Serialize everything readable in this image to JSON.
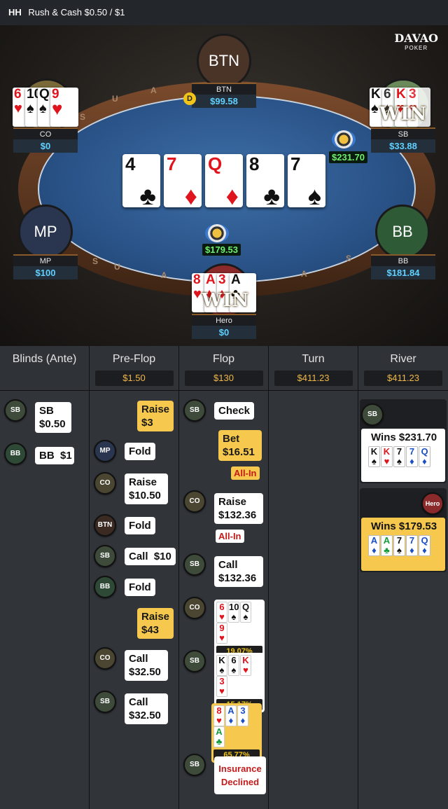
{
  "header": {
    "game_type": "HH",
    "title": "Rush & Cash $0.50 / $1"
  },
  "logo": {
    "brand": "DAVAO",
    "sub": "POKER"
  },
  "seats": {
    "btn": {
      "avatar": "BTN",
      "name": "BTN",
      "stack": "$99.58"
    },
    "co": {
      "name": "CO",
      "stack": "$0"
    },
    "sb": {
      "name": "SB",
      "stack": "$33.88"
    },
    "mp": {
      "avatar": "MP",
      "name": "MP",
      "stack": "$100"
    },
    "bb": {
      "avatar": "BB",
      "name": "BB",
      "stack": "$181.84"
    },
    "hero": {
      "name": "Hero",
      "stack": "$0"
    }
  },
  "hole_cards": {
    "co": [
      {
        "r": "6",
        "s": "♥",
        "c": "red"
      },
      {
        "r": "10",
        "s": "♠",
        "c": "blk"
      },
      {
        "r": "Q",
        "s": "♠",
        "c": "blk"
      },
      {
        "r": "9",
        "s": "♥",
        "c": "red"
      }
    ],
    "sb": [
      {
        "r": "K",
        "s": "♠",
        "c": "blk"
      },
      {
        "r": "6",
        "s": "♠",
        "c": "blk"
      },
      {
        "r": "K",
        "s": "♥",
        "c": "red"
      },
      {
        "r": "3",
        "s": "♥",
        "c": "red"
      }
    ],
    "hero": [
      {
        "r": "8",
        "s": "♥",
        "c": "red"
      },
      {
        "r": "A",
        "s": "♦",
        "c": "red"
      },
      {
        "r": "3",
        "s": "♦",
        "c": "red"
      },
      {
        "r": "A",
        "s": "♣",
        "c": "blk"
      }
    ]
  },
  "win_label": "WIN",
  "dealer_button": "D",
  "board": [
    {
      "r": "4",
      "s": "♣",
      "c": "blk"
    },
    {
      "r": "7",
      "s": "♦",
      "c": "red"
    },
    {
      "r": "Q",
      "s": "♦",
      "c": "red"
    },
    {
      "r": "8",
      "s": "♣",
      "c": "blk"
    },
    {
      "r": "7",
      "s": "♠",
      "c": "blk"
    }
  ],
  "pots": {
    "side": "$231.70",
    "main": "$179.53"
  },
  "rail_letters": [
    "A",
    "U",
    "S",
    "S",
    "A",
    "S",
    "A",
    "U"
  ],
  "streets": [
    {
      "name": "Blinds (Ante)",
      "pot": ""
    },
    {
      "name": "Pre-Flop",
      "pot": "$1.50"
    },
    {
      "name": "Flop",
      "pot": "$130"
    },
    {
      "name": "Turn",
      "pot": "$411.23"
    },
    {
      "name": "River",
      "pot": "$411.23"
    }
  ],
  "blinds_actions": [
    {
      "pos": "SB",
      "text": "SB $0.50"
    },
    {
      "pos": "BB",
      "text": "BB  $1"
    }
  ],
  "preflop_actions": [
    {
      "pos": "",
      "text": "Raise $3"
    },
    {
      "pos": "MP",
      "text": "Fold"
    },
    {
      "pos": "CO",
      "text": "Raise $10.50"
    },
    {
      "pos": "BTN",
      "text": "Fold"
    },
    {
      "pos": "SB",
      "text": "Call  $10"
    },
    {
      "pos": "BB",
      "text": "Fold"
    },
    {
      "pos": "",
      "text": "Raise $43"
    },
    {
      "pos": "CO",
      "text": "Call $32.50"
    },
    {
      "pos": "SB",
      "text": "Call $32.50"
    }
  ],
  "flop_actions": {
    "check": {
      "pos": "SB",
      "text": "Check"
    },
    "bet": {
      "text": "Bet $16.51",
      "tag": "All-In"
    },
    "raise": {
      "pos": "CO",
      "text": "Raise $132.36",
      "tag": "All-In"
    },
    "call": {
      "pos": "SB",
      "text": "Call $132.36"
    },
    "equity_co": {
      "pos": "CO",
      "cards": [
        {
          "r": "6",
          "s": "♥",
          "c": "red"
        },
        {
          "r": "10",
          "s": "♠",
          "c": "blk"
        },
        {
          "r": "Q",
          "s": "♠",
          "c": "blk"
        },
        {
          "r": "9",
          "s": "♥",
          "c": "red"
        }
      ],
      "pct": "19.07%"
    },
    "equity_sb": {
      "pos": "SB",
      "cards": [
        {
          "r": "K",
          "s": "♠",
          "c": "blk"
        },
        {
          "r": "6",
          "s": "♠",
          "c": "blk"
        },
        {
          "r": "K",
          "s": "♥",
          "c": "red"
        },
        {
          "r": "3",
          "s": "♥",
          "c": "red"
        }
      ],
      "pct": "15.17%"
    },
    "equity_hero": {
      "cards": [
        {
          "r": "8",
          "s": "♥",
          "c": "red"
        },
        {
          "r": "A",
          "s": "♦",
          "c": "blu"
        },
        {
          "r": "3",
          "s": "♦",
          "c": "blu"
        },
        {
          "r": "A",
          "s": "♣",
          "c": "grn"
        }
      ],
      "pct": "65.77%"
    },
    "insurance": {
      "pos": "SB",
      "text": "Insurance Declined"
    }
  },
  "river_results": [
    {
      "pos": "SB",
      "text": "Wins $231.70",
      "cards": [
        {
          "r": "K",
          "s": "♠",
          "c": "blk"
        },
        {
          "r": "K",
          "s": "♥",
          "c": "red"
        },
        {
          "r": "7",
          "s": "♠",
          "c": "blk"
        },
        {
          "r": "7",
          "s": "♦",
          "c": "blu"
        },
        {
          "r": "Q",
          "s": "♦",
          "c": "blu"
        }
      ]
    },
    {
      "pos": "Hero",
      "text": "Wins $179.53",
      "cards": [
        {
          "r": "A",
          "s": "♦",
          "c": "blu"
        },
        {
          "r": "A",
          "s": "♣",
          "c": "grn"
        },
        {
          "r": "7",
          "s": "♠",
          "c": "blk"
        },
        {
          "r": "7",
          "s": "♦",
          "c": "blu"
        },
        {
          "r": "Q",
          "s": "♦",
          "c": "blu"
        }
      ]
    }
  ],
  "colors": {
    "accent": "#f6c84e",
    "stack": "#5fd0ff",
    "pot": "#6ef06e",
    "alert": "#c31a1a"
  }
}
